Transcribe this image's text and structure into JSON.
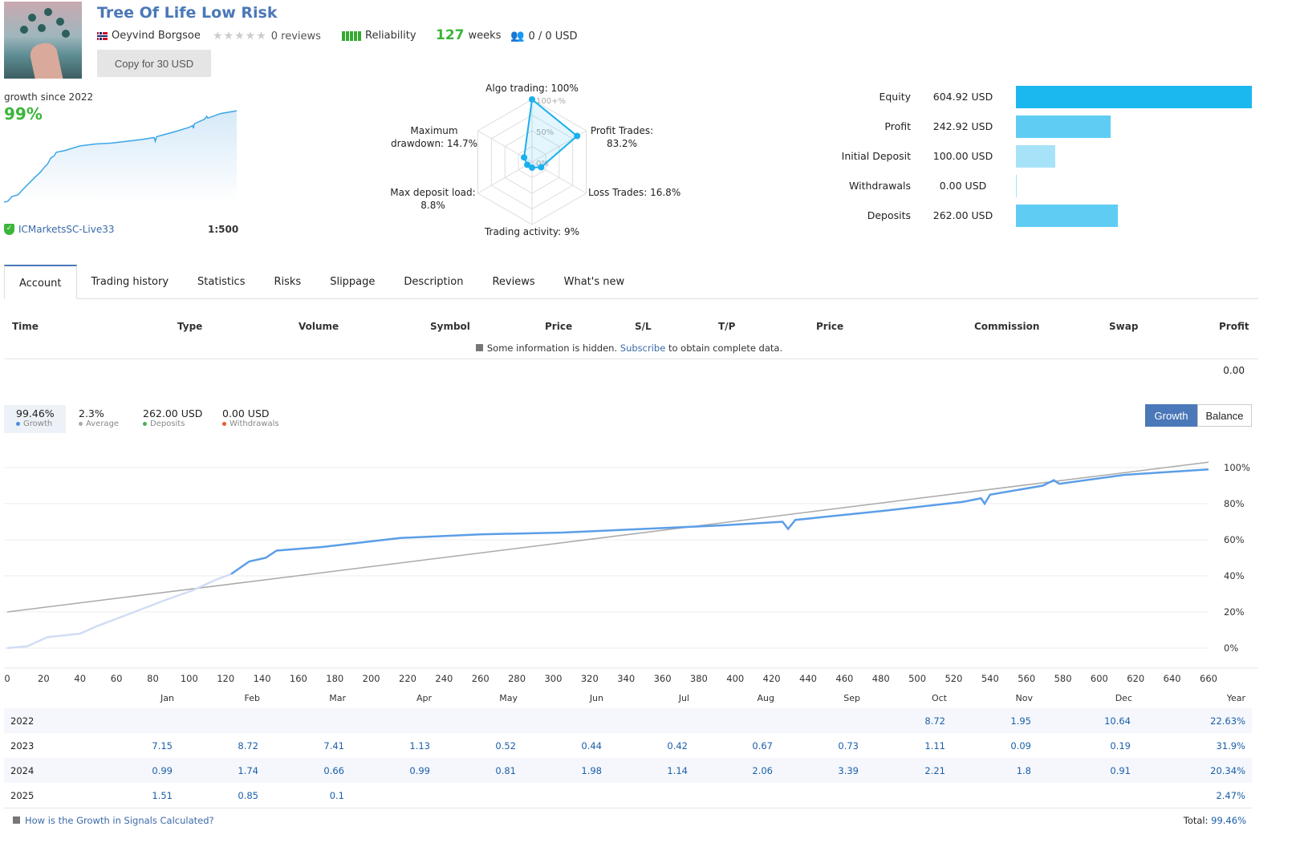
{
  "header": {
    "title": "Tree Of Life Low Risk",
    "author": "Oeyvind Borgsoe",
    "reviews": "0 reviews",
    "rating_stars": 0,
    "reliability_label": "Reliability",
    "weeks_value": "127",
    "weeks_label": "weeks",
    "subscribers": "0 / 0 USD",
    "copy_button": "Copy for 30 USD"
  },
  "summary": {
    "growth_label": "growth since 2022",
    "growth_value": "99%",
    "broker": "ICMarketsSC-Live33",
    "leverage": "1:500"
  },
  "radar": {
    "ring_labels": [
      "100+%",
      "50%",
      "0%"
    ],
    "axes": [
      {
        "label": "Algo trading: 100%",
        "value": 100
      },
      {
        "label": "Profit Trades: 83.2%",
        "value": 83.2
      },
      {
        "label": "Loss Trades: 16.8%",
        "value": 16.8
      },
      {
        "label": "Trading activity: 9%",
        "value": 9
      },
      {
        "label": "Max deposit load: 8.8%",
        "value": 8.8
      },
      {
        "label": "Maximum drawdown: 14.7%",
        "value": 14.7
      }
    ],
    "color": "#1ab0ec"
  },
  "equity": [
    {
      "label": "Equity",
      "value": "604.92 USD",
      "amount": 604.92,
      "color": "#1ab8ee"
    },
    {
      "label": "Profit",
      "value": "242.92 USD",
      "amount": 242.92,
      "color": "#5fcdf3"
    },
    {
      "label": "Initial Deposit",
      "value": "100.00 USD",
      "amount": 100,
      "color": "#a7e3f8"
    },
    {
      "label": "Withdrawals",
      "value": "0.00 USD",
      "amount": 0,
      "color": "#a7e3f8"
    },
    {
      "label": "Deposits",
      "value": "262.00 USD",
      "amount": 262,
      "color": "#5fcdf3"
    }
  ],
  "tabs": [
    "Account",
    "Trading history",
    "Statistics",
    "Risks",
    "Slippage",
    "Description",
    "Reviews",
    "What's new"
  ],
  "positions": {
    "headers": [
      "Time",
      "Type",
      "Volume",
      "Symbol",
      "Price",
      "S/L",
      "T/P",
      "Price",
      "Commission",
      "Swap",
      "Profit"
    ],
    "note_before": "Some information is hidden.",
    "note_link": "Subscribe",
    "note_after": "to obtain complete data.",
    "total": "0.00"
  },
  "stats": [
    {
      "value": "99.46%",
      "label": "Growth",
      "color": "#4a90e2"
    },
    {
      "value": "2.3%",
      "label": "Average",
      "color": "#aaaaaa"
    },
    {
      "value": "262.00 USD",
      "label": "Deposits",
      "color": "#4caf50"
    },
    {
      "value": "0.00 USD",
      "label": "Withdrawals",
      "color": "#ef5a2a"
    }
  ],
  "chart_toggle": {
    "growth": "Growth",
    "balance": "Balance",
    "active": "Growth"
  },
  "chart_data": {
    "type": "line",
    "xlim": [
      0,
      660
    ],
    "ylim": [
      -5,
      105
    ],
    "x_ticks": [
      0,
      20,
      40,
      60,
      80,
      100,
      120,
      140,
      160,
      180,
      200,
      220,
      240,
      260,
      280,
      300,
      320,
      340,
      360,
      380,
      400,
      420,
      440,
      460,
      480,
      500,
      520,
      540,
      560,
      580,
      600,
      620,
      640,
      660
    ],
    "y_ticks": [
      "0%",
      "20%",
      "40%",
      "60%",
      "80%",
      "100%"
    ],
    "y_tick_values": [
      0,
      20,
      40,
      60,
      80,
      100
    ],
    "grid": true,
    "series": [
      {
        "color": "#5b9ee8",
        "faded_until": 123,
        "faded_color": "#d2dcf5",
        "points": [
          [
            0,
            0
          ],
          [
            11,
            1
          ],
          [
            22,
            6
          ],
          [
            40,
            8
          ],
          [
            49,
            12
          ],
          [
            62,
            17
          ],
          [
            75,
            22
          ],
          [
            88,
            27
          ],
          [
            102,
            32
          ],
          [
            115,
            38
          ],
          [
            123,
            41
          ],
          [
            133,
            48
          ],
          [
            142,
            50
          ],
          [
            148,
            54
          ],
          [
            173,
            56
          ],
          [
            216,
            61
          ],
          [
            260,
            63
          ],
          [
            305,
            64
          ],
          [
            349,
            66
          ],
          [
            393,
            68
          ],
          [
            426,
            70
          ],
          [
            429,
            66
          ],
          [
            433,
            71
          ],
          [
            481,
            76
          ],
          [
            525,
            81
          ],
          [
            535,
            83
          ],
          [
            537,
            80
          ],
          [
            540,
            85
          ],
          [
            569,
            90
          ],
          [
            575,
            93
          ],
          [
            578,
            91
          ],
          [
            614,
            96
          ],
          [
            660,
            99
          ]
        ]
      },
      {
        "color": "#aaaaaa",
        "points": [
          [
            0,
            20
          ],
          [
            660,
            103
          ]
        ]
      }
    ]
  },
  "monthly": {
    "headers": [
      "Jan",
      "Feb",
      "Mar",
      "Apr",
      "May",
      "Jun",
      "Jul",
      "Aug",
      "Sep",
      "Oct",
      "Nov",
      "Dec",
      "Year"
    ],
    "rows": [
      {
        "year": "2022",
        "values": [
          "",
          "",
          "",
          "",
          "",
          "",
          "",
          "",
          "",
          "8.72",
          "1.95",
          "10.64",
          "22.63%"
        ]
      },
      {
        "year": "2023",
        "values": [
          "7.15",
          "8.72",
          "7.41",
          "1.13",
          "0.52",
          "0.44",
          "0.42",
          "0.67",
          "0.73",
          "1.11",
          "0.09",
          "0.19",
          "31.9%"
        ]
      },
      {
        "year": "2024",
        "values": [
          "0.99",
          "1.74",
          "0.66",
          "0.99",
          "0.81",
          "1.98",
          "1.14",
          "2.06",
          "3.39",
          "2.21",
          "1.8",
          "0.91",
          "20.34%"
        ]
      },
      {
        "year": "2025",
        "values": [
          "1.51",
          "0.85",
          "0.1",
          "",
          "",
          "",
          "",
          "",
          "",
          "",
          "",
          "",
          "2.47%"
        ]
      }
    ],
    "faq": "How is the Growth in Signals Calculated?",
    "total_label": "Total:",
    "total_value": "99.46%"
  }
}
